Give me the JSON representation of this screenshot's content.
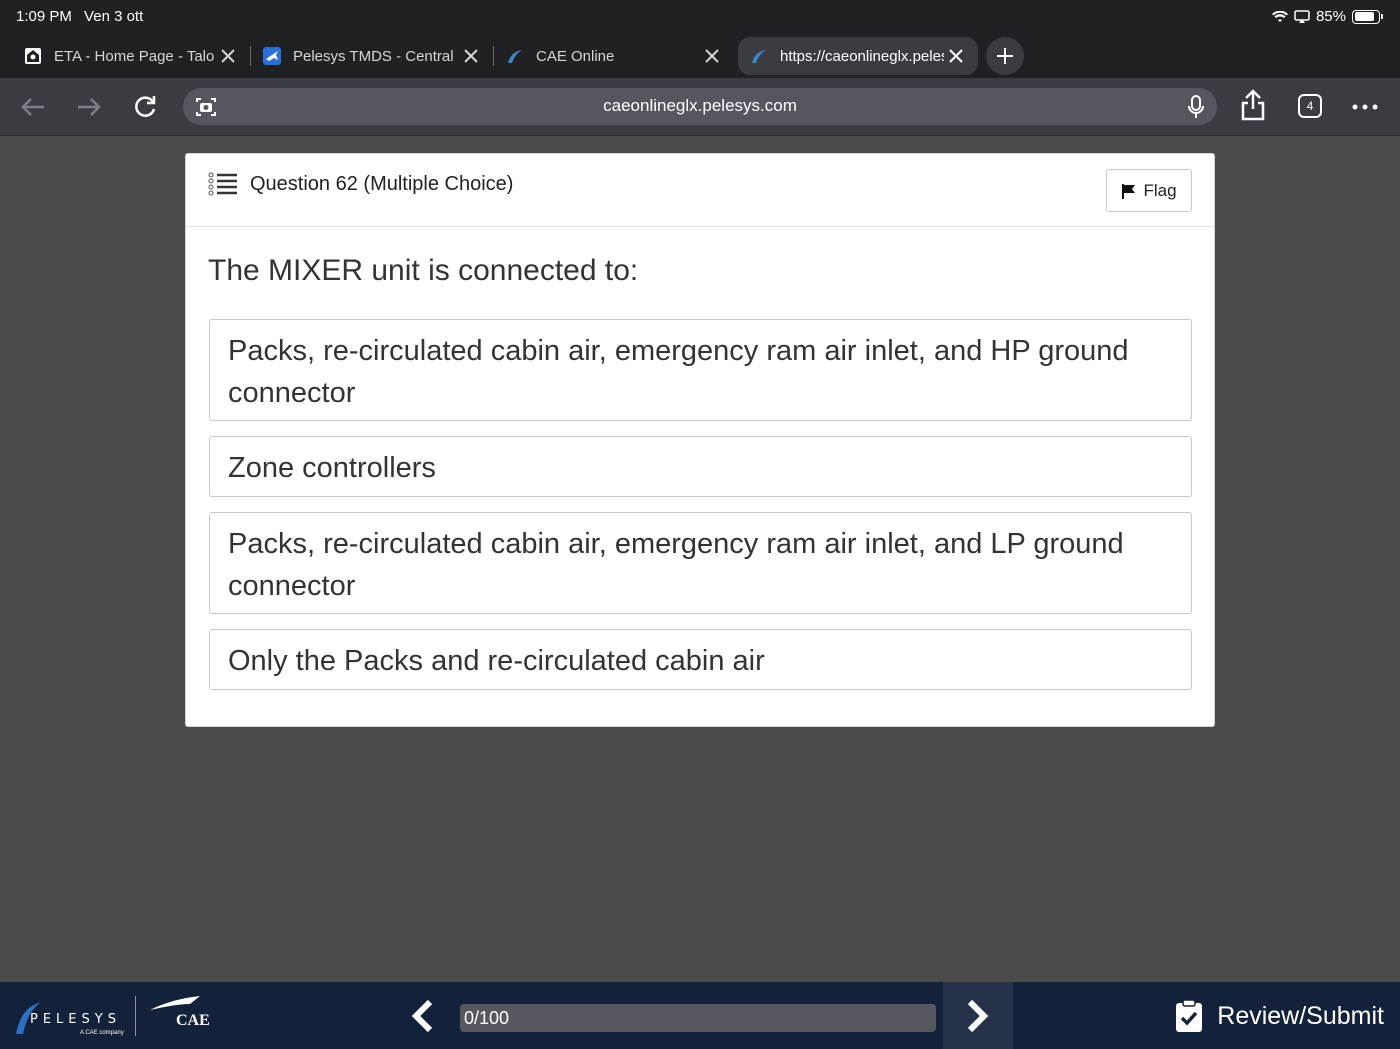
{
  "status_bar": {
    "time": "1:09 PM",
    "date": "Ven 3 ott",
    "battery": "85%",
    "battery_level": 0.85
  },
  "tabs": [
    {
      "label": "ETA - Home Page - Talon",
      "icon": "home-icon"
    },
    {
      "label": "Pelesys TMDS - Central",
      "icon": "plane-icon"
    },
    {
      "label": "CAE Online",
      "icon": "pelesys-icon"
    },
    {
      "label": "https://caeonlineglx.pelesys.com",
      "icon": "pelesys-icon",
      "active": true
    }
  ],
  "toolbar": {
    "url": "caeonlineglx.pelesys.com",
    "tab_count": "4"
  },
  "question": {
    "title": "Question 62 (Multiple Choice)",
    "flag_label": "Flag",
    "text": "The MIXER unit is connected to:",
    "options": [
      "Packs, re-circulated cabin air, emergency ram air inlet, and HP ground connector",
      "Zone controllers",
      "Packs, re-circulated cabin air, emergency ram air inlet, and LP ground connector",
      "Only the Packs and re-circulated cabin air"
    ]
  },
  "footer": {
    "brand": "PELESYS",
    "brand_sub": "A CAE company",
    "partner": "CAE",
    "progress_text": "0/100",
    "progress_value": 0,
    "review_label": "Review/Submit"
  },
  "colors": {
    "footer_bg": "#14213a",
    "page_bg": "#4a4a4a",
    "chrome_bg": "#1f2125",
    "toolbar_bg": "#3a3c42"
  }
}
